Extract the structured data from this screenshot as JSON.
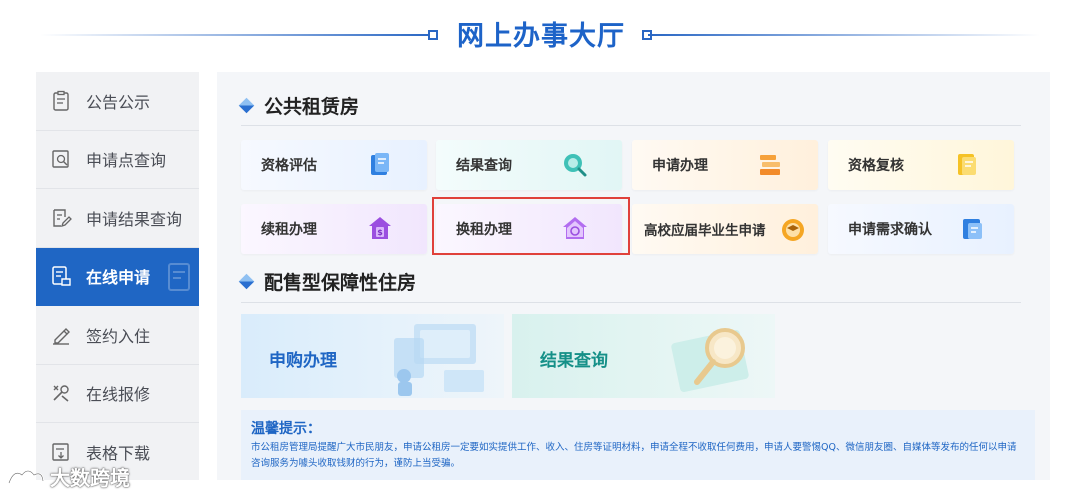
{
  "header": {
    "title": "网上办事大厅"
  },
  "sidebar": {
    "items": [
      {
        "label": "公告公示",
        "icon": "notice-board-icon"
      },
      {
        "label": "申请点查询",
        "icon": "search-document-icon"
      },
      {
        "label": "申请结果查询",
        "icon": "edit-document-icon"
      },
      {
        "label": "在线申请",
        "icon": "online-apply-icon",
        "active": true
      },
      {
        "label": "签约入住",
        "icon": "sign-pen-icon"
      },
      {
        "label": "在线报修",
        "icon": "repair-tools-icon"
      },
      {
        "label": "表格下载",
        "icon": "download-form-icon"
      }
    ]
  },
  "public_rental": {
    "title": "公共租赁房",
    "cards": [
      {
        "label": "资格评估",
        "icon": "assessment-doc-icon"
      },
      {
        "label": "结果查询",
        "icon": "result-search-icon"
      },
      {
        "label": "申请办理",
        "icon": "apply-stack-icon"
      },
      {
        "label": "资格复核",
        "icon": "review-doc-icon"
      },
      {
        "label": "续租办理",
        "icon": "renew-house-icon"
      },
      {
        "label": "换租办理",
        "icon": "exchange-house-icon"
      },
      {
        "label": "高校应届毕业生申请",
        "icon": "graduate-cap-icon"
      },
      {
        "label": "申请需求确认",
        "icon": "confirm-doc-icon"
      }
    ]
  },
  "affordable_housing": {
    "title": "配售型保障性住房",
    "banners": [
      {
        "label": "申购办理",
        "icon": "purchase-illustration"
      },
      {
        "label": "结果查询",
        "icon": "magnifier-illustration"
      }
    ]
  },
  "notice": {
    "title": "温馨提示：",
    "body": "市公租房管理局提醒广大市民朋友，申请公租房一定要如实提供工作、收入、住房等证明材料，申请全程不收取任何费用，申请人要警惕QQ、微信朋友圈、自媒体等发布的任何以申请咨询服务为噱头收取钱财的行为，谨防上当受骗。"
  },
  "watermark": {
    "text": "大数跨境"
  },
  "colors": {
    "primary": "#1f66c4",
    "highlight": "#e0413b"
  }
}
